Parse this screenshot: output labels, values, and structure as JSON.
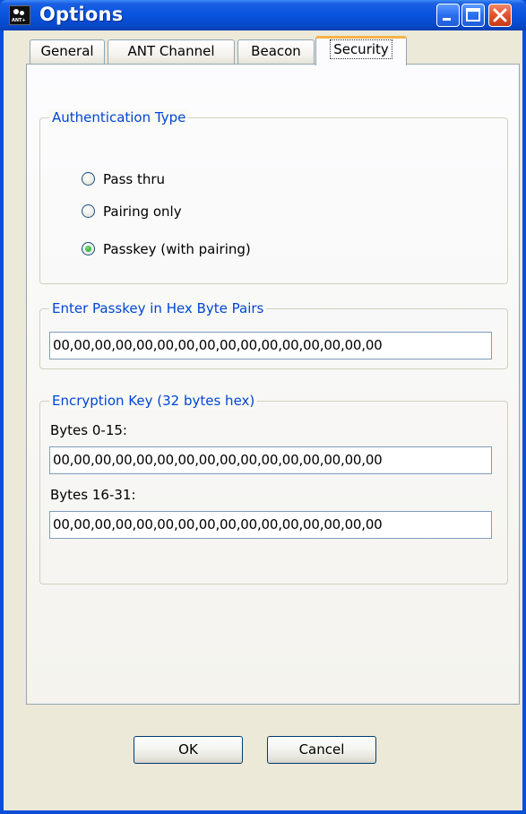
{
  "window": {
    "title": "Options",
    "icon_text": "ANT+"
  },
  "tabs": [
    {
      "label": "General",
      "active": false
    },
    {
      "label": "ANT Channel",
      "active": false
    },
    {
      "label": "Beacon",
      "active": false
    },
    {
      "label": "Security",
      "active": true
    }
  ],
  "auth": {
    "legend": "Authentication Type",
    "options": [
      {
        "label": "Pass thru",
        "checked": false
      },
      {
        "label": "Pairing only",
        "checked": false
      },
      {
        "label": "Passkey (with pairing)",
        "checked": true
      }
    ]
  },
  "passkey": {
    "legend": "Enter Passkey in Hex Byte Pairs",
    "value": "00,00,00,00,00,00,00,00,00,00,00,00,00,00,00,00"
  },
  "encryption": {
    "legend": "Encryption Key (32 bytes hex)",
    "bytes_0_15_label": "Bytes 0-15:",
    "bytes_0_15_value": "00,00,00,00,00,00,00,00,00,00,00,00,00,00,00,00",
    "bytes_16_31_label": "Bytes 16-31:",
    "bytes_16_31_value": "00,00,00,00,00,00,00,00,00,00,00,00,00,00,00,00"
  },
  "buttons": {
    "ok": "OK",
    "cancel": "Cancel"
  }
}
